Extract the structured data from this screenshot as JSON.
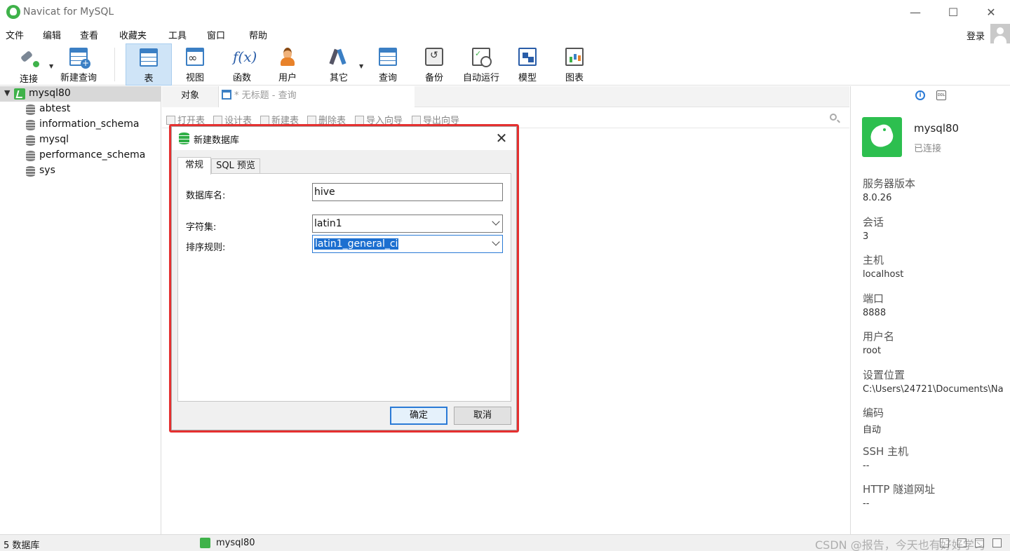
{
  "window": {
    "title": "Navicat for MySQL"
  },
  "menu": {
    "items": [
      "文件",
      "编辑",
      "查看",
      "收藏夹",
      "工具",
      "窗口",
      "帮助"
    ],
    "login": "登录"
  },
  "toolbar": {
    "items": [
      {
        "label": "连接",
        "icon": "plug-icon"
      },
      {
        "label": "新建查询",
        "icon": "new-query-icon"
      },
      {
        "label": "表",
        "icon": "table-icon",
        "active": true
      },
      {
        "label": "视图",
        "icon": "view-icon"
      },
      {
        "label": "函数",
        "icon": "function-icon"
      },
      {
        "label": "用户",
        "icon": "user-icon"
      },
      {
        "label": "其它",
        "icon": "tools-icon"
      },
      {
        "label": "查询",
        "icon": "query-icon"
      },
      {
        "label": "备份",
        "icon": "backup-icon"
      },
      {
        "label": "自动运行",
        "icon": "automation-icon"
      },
      {
        "label": "模型",
        "icon": "model-icon"
      },
      {
        "label": "图表",
        "icon": "chart-icon"
      }
    ]
  },
  "tree": {
    "connection": "mysql80",
    "databases": [
      "abtest",
      "information_schema",
      "mysql",
      "performance_schema",
      "sys"
    ]
  },
  "tabs": {
    "objects": "对象",
    "query": "* 无标题 - 查询"
  },
  "object_toolbar": [
    "打开表",
    "设计表",
    "新建表",
    "删除表",
    "导入向导",
    "导出向导"
  ],
  "dialog": {
    "title": "新建数据库",
    "tabs": [
      "常规",
      "SQL 预览"
    ],
    "fields": {
      "db_name_label": "数据库名:",
      "db_name_value": "hive",
      "charset_label": "字符集:",
      "charset_value": "latin1",
      "collation_label": "排序规则:",
      "collation_value": "latin1_general_ci"
    },
    "ok": "确定",
    "cancel": "取消"
  },
  "info": {
    "name": "mysql80",
    "state": "已连接",
    "props": [
      {
        "label": "服务器版本",
        "value": "8.0.26"
      },
      {
        "label": "会话",
        "value": "3"
      },
      {
        "label": "主机",
        "value": "localhost"
      },
      {
        "label": "端口",
        "value": "8888"
      },
      {
        "label": "用户名",
        "value": "root"
      },
      {
        "label": "设置位置",
        "value": "C:\\Users\\24721\\Documents\\Na"
      },
      {
        "label": "编码",
        "value": "自动"
      },
      {
        "label": "SSH 主机",
        "value": "--"
      },
      {
        "label": "HTTP 隧道网址",
        "value": "--"
      }
    ]
  },
  "status": {
    "count": "5 数据库",
    "connection": "mysql80",
    "watermark": "CSDN @报告，今天也有好好学习"
  },
  "colors": {
    "accent": "#2a7ad6",
    "brand_green": "#3fb24a",
    "highlight_red": "#e53030"
  }
}
